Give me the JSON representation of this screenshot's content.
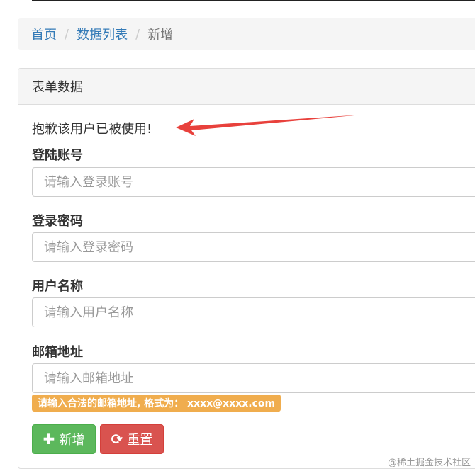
{
  "breadcrumb": {
    "items": [
      "首页",
      "数据列表"
    ],
    "separator": "/",
    "active": "新增"
  },
  "panel": {
    "title": "表单数据"
  },
  "form": {
    "error_message": "抱歉该用户已被使用!",
    "fields": [
      {
        "label": "登陆账号",
        "placeholder": "请输入登录账号"
      },
      {
        "label": "登录密码",
        "placeholder": "请输入登录密码"
      },
      {
        "label": "用户名称",
        "placeholder": "请输入用户名称"
      },
      {
        "label": "邮箱地址",
        "placeholder": "请输入邮箱地址"
      }
    ],
    "email_hint": "请输入合法的邮箱地址, 格式为： xxxx@xxxx.com",
    "add_button": {
      "icon": "plus-icon",
      "label": "新增"
    },
    "reset_button": {
      "icon": "refresh-icon",
      "label": "重置"
    }
  },
  "watermark": "@稀土掘金技术社区",
  "colors": {
    "link": "#337ab7",
    "success": "#5cb85c",
    "danger": "#d9534f",
    "warning": "#f0ad4e",
    "arrow": "#e8413c"
  }
}
